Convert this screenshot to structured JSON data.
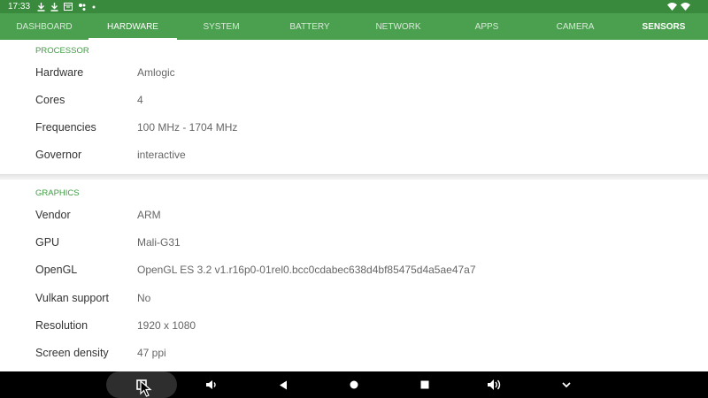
{
  "status_bar": {
    "time": "17:33",
    "left_icons": [
      "download-icon",
      "download-icon",
      "calendar-icon",
      "bluetooth-icon",
      "dot-icon"
    ],
    "right_icons": [
      "wifi-icon",
      "wifi-icon"
    ]
  },
  "tabs": [
    {
      "label": "DASHBOARD"
    },
    {
      "label": "HARDWARE"
    },
    {
      "label": "SYSTEM"
    },
    {
      "label": "BATTERY"
    },
    {
      "label": "NETWORK"
    },
    {
      "label": "APPS"
    },
    {
      "label": "CAMERA"
    },
    {
      "label": "SENSORS"
    }
  ],
  "processor": {
    "title": "PROCESSOR",
    "rows": [
      {
        "label": "Hardware",
        "value": " Amlogic"
      },
      {
        "label": "Cores",
        "value": "4"
      },
      {
        "label": "Frequencies",
        "value": "100 MHz - 1704 MHz"
      },
      {
        "label": "Governor",
        "value": "interactive"
      }
    ]
  },
  "graphics": {
    "title": "GRAPHICS",
    "rows": [
      {
        "label": "Vendor",
        "value": "ARM"
      },
      {
        "label": "GPU",
        "value": "Mali-G31"
      },
      {
        "label": "OpenGL",
        "value": "OpenGL ES 3.2 v1.r16p0-01rel0.bcc0cdabec638d4bf85475d4a5ae47a7"
      },
      {
        "label": "Vulkan support",
        "value": "No"
      },
      {
        "label": "Resolution",
        "value": "1920 x 1080"
      },
      {
        "label": "Screen density",
        "value": "47 ppi"
      }
    ]
  },
  "nav_bar": {
    "buttons": [
      "screenshot-icon",
      "volume-down-icon",
      "back-icon",
      "home-icon",
      "recents-icon",
      "volume-up-icon",
      "chevron-down-icon"
    ]
  }
}
